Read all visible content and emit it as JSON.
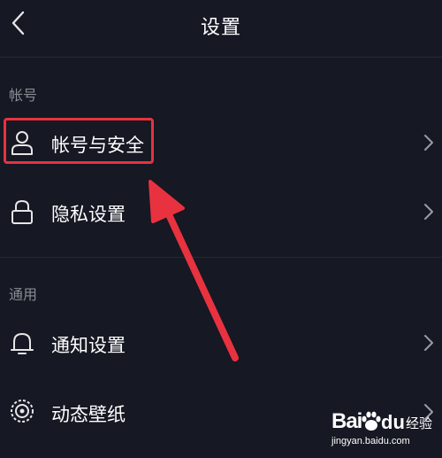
{
  "header": {
    "title": "设置"
  },
  "sections": [
    {
      "label": "帐号",
      "items": [
        {
          "label": "帐号与安全",
          "icon": "user-icon"
        },
        {
          "label": "隐私设置",
          "icon": "lock-icon"
        }
      ]
    },
    {
      "label": "通用",
      "items": [
        {
          "label": "通知设置",
          "icon": "bell-icon"
        },
        {
          "label": "动态壁纸",
          "icon": "wallpaper-icon"
        }
      ]
    }
  ],
  "annotation": {
    "highlight_color": "#e8323f",
    "highlighted_item": "帐号与安全"
  },
  "watermark": {
    "brand_left": "Bai",
    "brand_right": "du",
    "product": "经验",
    "url": "jingyan.baidu.com"
  },
  "colors": {
    "background": "#161823",
    "text": "#ffffff",
    "muted": "#8a8c94",
    "divider": "#262934"
  }
}
